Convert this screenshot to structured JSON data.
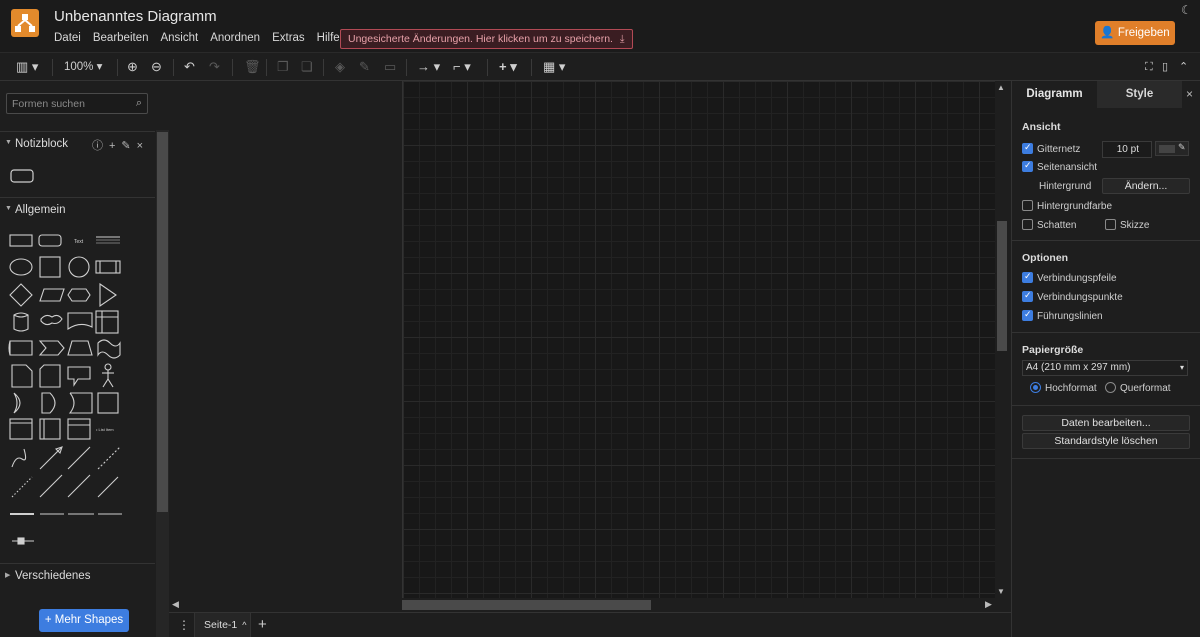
{
  "app": {
    "title": "Unbenanntes Diagramm",
    "menu": [
      "Datei",
      "Bearbeiten",
      "Ansicht",
      "Anordnen",
      "Extras",
      "Hilfe"
    ],
    "unsaved_notice": "Ungesicherte Änderungen. Hier klicken um zu speichern.",
    "share_label": "Freigeben"
  },
  "toolbar": {
    "zoom": "100%"
  },
  "sidebar": {
    "search_placeholder": "Formen suchen",
    "sections": {
      "notizblock": "Notizblock",
      "allgemein": "Allgemein",
      "verschiedenes": "Verschiedenes"
    },
    "more_shapes": "Mehr Shapes"
  },
  "pages": {
    "current": "Seite-1"
  },
  "format_panel": {
    "tabs": [
      "Diagramm",
      "Style"
    ],
    "ansicht": {
      "heading": "Ansicht",
      "gitternetz": "Gitternetz",
      "grid_size": "10 pt",
      "seitenansicht": "Seitenansicht",
      "hintergrund": "Hintergrund",
      "aendern": "Ändern...",
      "hintergrundfarbe": "Hintergrundfarbe",
      "schatten": "Schatten",
      "skizze": "Skizze"
    },
    "optionen": {
      "heading": "Optionen",
      "verbindungspfeile": "Verbindungspfeile",
      "verbindungspunkte": "Verbindungspunkte",
      "fuehrungslinien": "Führungslinien"
    },
    "papier": {
      "heading": "Papiergröße",
      "format": "A4 (210 mm x 297 mm)",
      "hochformat": "Hochformat",
      "querformat": "Querformat"
    },
    "daten_bearbeiten": "Daten bearbeiten...",
    "standardstyle": "Standardstyle löschen"
  },
  "colors": {
    "accent": "#3d7de0",
    "brand": "#e28a2c"
  }
}
